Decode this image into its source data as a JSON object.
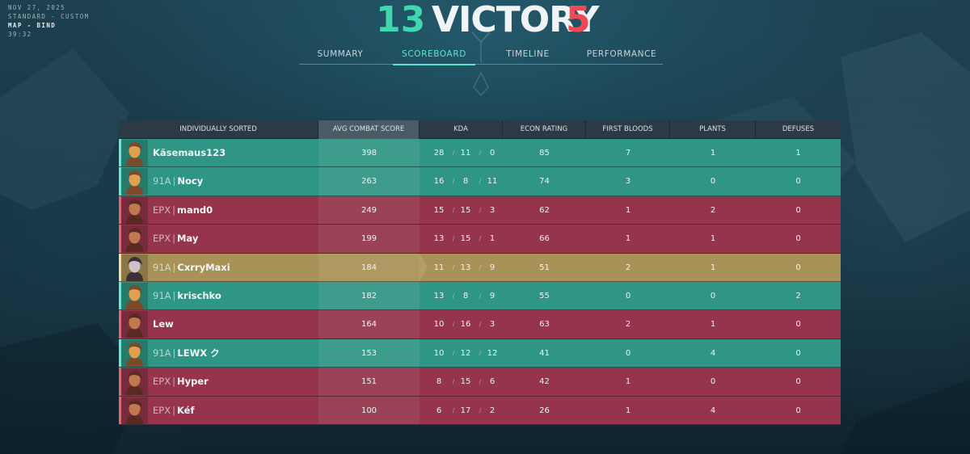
{
  "match": {
    "date": "NOV 27, 2025",
    "mode": "STANDARD - CUSTOM",
    "map": "MAP - BIND",
    "duration": "39:32"
  },
  "result": {
    "team_score": "13",
    "label": "VICTORY",
    "enemy_score": "5",
    "team_color": "#3fd6b0",
    "enemy_color": "#f04a56"
  },
  "tabs": [
    {
      "label": "SUMMARY",
      "active": false
    },
    {
      "label": "SCOREBOARD",
      "active": true
    },
    {
      "label": "TIMELINE",
      "active": false
    },
    {
      "label": "PERFORMANCE",
      "active": false
    }
  ],
  "table": {
    "headers": [
      "INDIVIDUALLY SORTED",
      "AVG COMBAT SCORE",
      "KDA",
      "ECON RATING",
      "FIRST BLOODS",
      "PLANTS",
      "DEFUSES"
    ],
    "kda_separator": "/",
    "rows": [
      {
        "team": "a",
        "tag": "",
        "name": "Käsemaus123",
        "acs": "398",
        "k": "28",
        "d": "11",
        "a": "0",
        "econ": "85",
        "fb": "7",
        "plants": "1",
        "defuses": "1",
        "avatar": "agent-portrait-icon"
      },
      {
        "team": "a",
        "tag": "91A",
        "name": "Nocy",
        "acs": "263",
        "k": "16",
        "d": "8",
        "a": "11",
        "econ": "74",
        "fb": "3",
        "plants": "0",
        "defuses": "0",
        "avatar": "agent-portrait-icon"
      },
      {
        "team": "b",
        "tag": "EPX",
        "name": "mand0",
        "acs": "249",
        "k": "15",
        "d": "15",
        "a": "3",
        "econ": "62",
        "fb": "1",
        "plants": "2",
        "defuses": "0",
        "avatar": "agent-portrait-icon"
      },
      {
        "team": "b",
        "tag": "EPX",
        "name": "May",
        "acs": "199",
        "k": "13",
        "d": "15",
        "a": "1",
        "econ": "66",
        "fb": "1",
        "plants": "1",
        "defuses": "0",
        "avatar": "agent-portrait-icon"
      },
      {
        "team": "self",
        "tag": "91A",
        "name": "CxrryMaxi",
        "acs": "184",
        "k": "11",
        "d": "13",
        "a": "9",
        "econ": "51",
        "fb": "2",
        "plants": "1",
        "defuses": "0",
        "avatar": "agent-portrait-icon"
      },
      {
        "team": "a",
        "tag": "91A",
        "name": "krischko",
        "acs": "182",
        "k": "13",
        "d": "8",
        "a": "9",
        "econ": "55",
        "fb": "0",
        "plants": "0",
        "defuses": "2",
        "avatar": "agent-portrait-icon"
      },
      {
        "team": "b",
        "tag": "",
        "name": "Lew",
        "acs": "164",
        "k": "10",
        "d": "16",
        "a": "3",
        "econ": "63",
        "fb": "2",
        "plants": "1",
        "defuses": "0",
        "avatar": "agent-portrait-icon"
      },
      {
        "team": "a",
        "tag": "91A",
        "name": "LEWX ク",
        "acs": "153",
        "k": "10",
        "d": "12",
        "a": "12",
        "econ": "41",
        "fb": "0",
        "plants": "4",
        "defuses": "0",
        "avatar": "agent-portrait-icon"
      },
      {
        "team": "b",
        "tag": "EPX",
        "name": "Hyper",
        "acs": "151",
        "k": "8",
        "d": "15",
        "a": "6",
        "econ": "42",
        "fb": "1",
        "plants": "0",
        "defuses": "0",
        "avatar": "agent-portrait-icon"
      },
      {
        "team": "b",
        "tag": "EPX",
        "name": "Kéf",
        "acs": "100",
        "k": "6",
        "d": "17",
        "a": "2",
        "econ": "26",
        "fb": "1",
        "plants": "4",
        "defuses": "0",
        "avatar": "agent-portrait-icon"
      }
    ]
  }
}
